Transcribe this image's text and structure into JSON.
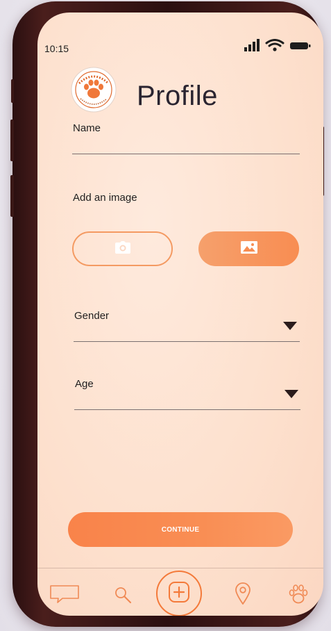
{
  "status_bar": {
    "time": "10:15"
  },
  "header": {
    "title": "Profile",
    "logo_icon": "pawpal-logo-icon"
  },
  "form": {
    "name_label": "Name",
    "name_value": "",
    "image_label": "Add an image",
    "camera_icon": "camera-icon",
    "gallery_icon": "image-icon",
    "gender_label": "Gender",
    "gender_value": "",
    "age_label": "Age",
    "age_value": ""
  },
  "continue_label": "CONTINUE",
  "tabbar": {
    "items": [
      "chat-icon",
      "search-icon",
      "add-icon",
      "location-pin-icon",
      "paw-icon"
    ]
  },
  "colors": {
    "accent": "#f98e54",
    "accent_outline": "#f49a62",
    "background": "#fde3d2",
    "title_text": "#2a2430"
  }
}
